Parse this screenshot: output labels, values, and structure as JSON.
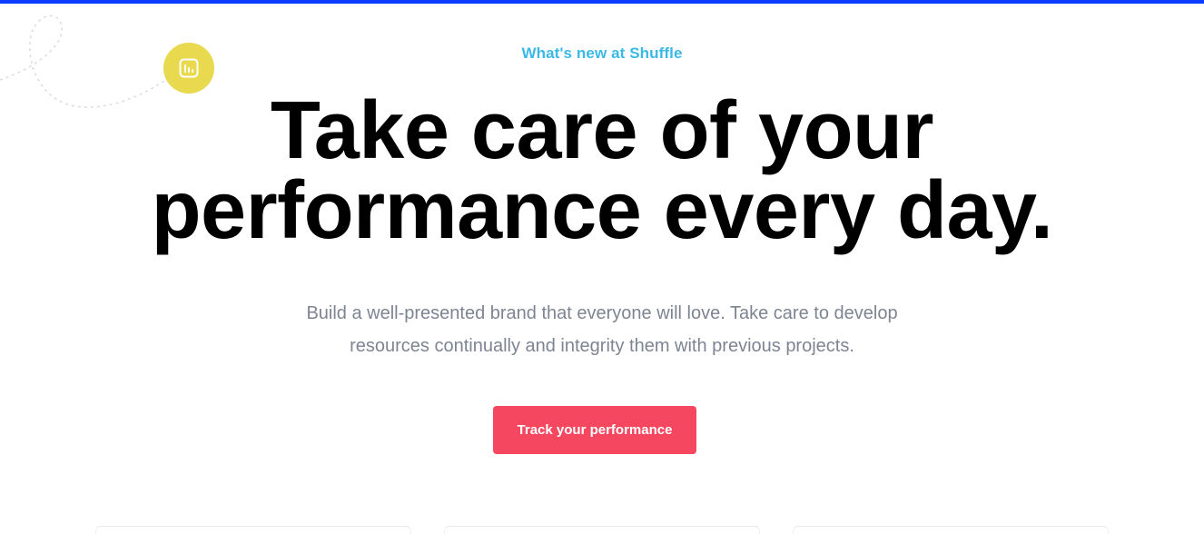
{
  "hero": {
    "eyebrow": "What's new at Shuffle",
    "headline_line1": "Take care of your",
    "headline_line2": "performance every day.",
    "subtext_line1": "Build a well-presented brand that everyone will love. Take care to develop",
    "subtext_line2": "resources continually and integrity them with previous projects.",
    "cta_label": "Track your performance"
  },
  "icons": {
    "badge": "bar-chart-icon"
  },
  "colors": {
    "top_bar": "#0b3cff",
    "eyebrow": "#3bb9e6",
    "badge_bg": "#e8d94f",
    "cta_bg": "#f5475f",
    "headline": "#000000",
    "subtext": "#7d8592"
  }
}
